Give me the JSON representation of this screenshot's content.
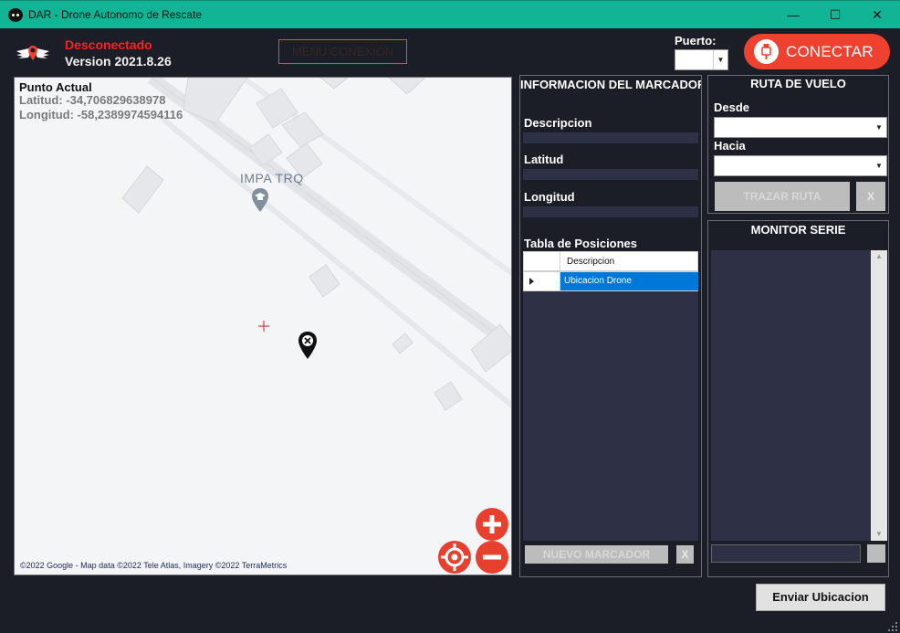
{
  "window": {
    "title": "DAR - Drone Autonomo de Rescate",
    "controls": {
      "minimize": "—",
      "maximize": "☐",
      "close": "✕"
    }
  },
  "header": {
    "status": "Desconectado",
    "version": "Version 2021.8.26",
    "menu_button": "MENU CONEXION",
    "puerto_label": "Puerto:",
    "puerto_value": "",
    "connect_button": "CONECTAR"
  },
  "map": {
    "current_point_title": "Punto Actual",
    "latitude": "Latitud: -34,706829638978",
    "longitude": "Longitud: -58,2389974594116",
    "poi_label": "IMPA TRQ",
    "copyright": "©2022 Google - Map data ©2022 Tele Atlas, Imagery ©2022 TerraMetrics",
    "marker_symbol": "x",
    "icons": [
      "zoom-in-icon",
      "zoom-out-icon",
      "locate-icon",
      "crosshair-icon",
      "drone-marker-icon"
    ]
  },
  "info_panel": {
    "title": "INFORMACION DEL MARCADOR",
    "descripcion_label": "Descripcion",
    "latitud_label": "Latitud",
    "longitud_label": "Longitud",
    "descripcion_value": "",
    "latitud_value": "",
    "longitud_value": "",
    "tabla_title": "Tabla de Posiciones",
    "grid_columns": [
      "Descripcion"
    ],
    "grid_rows": [
      {
        "descripcion": "Ubicacion Drone",
        "selected": true
      }
    ],
    "nuevo_button": "NUEVO MARCADOR",
    "delete_button": "X"
  },
  "ruta_panel": {
    "title": "RUTA DE VUELO",
    "desde_label": "Desde",
    "hacia_label": "Hacia",
    "desde_value": "",
    "hacia_value": "",
    "trazar_button": "TRAZAR RUTA",
    "clear_button": "X"
  },
  "monitor_panel": {
    "title": "MONITOR SERIE",
    "input_value": ""
  },
  "enviar_button": "Enviar Ubicacion",
  "colors": {
    "title_bar": "#12b496",
    "background": "#1b1d27",
    "accent": "#ef4130",
    "status_disconnected": "#ff2020",
    "selection": "#0078d7",
    "field": "#2e3145"
  }
}
